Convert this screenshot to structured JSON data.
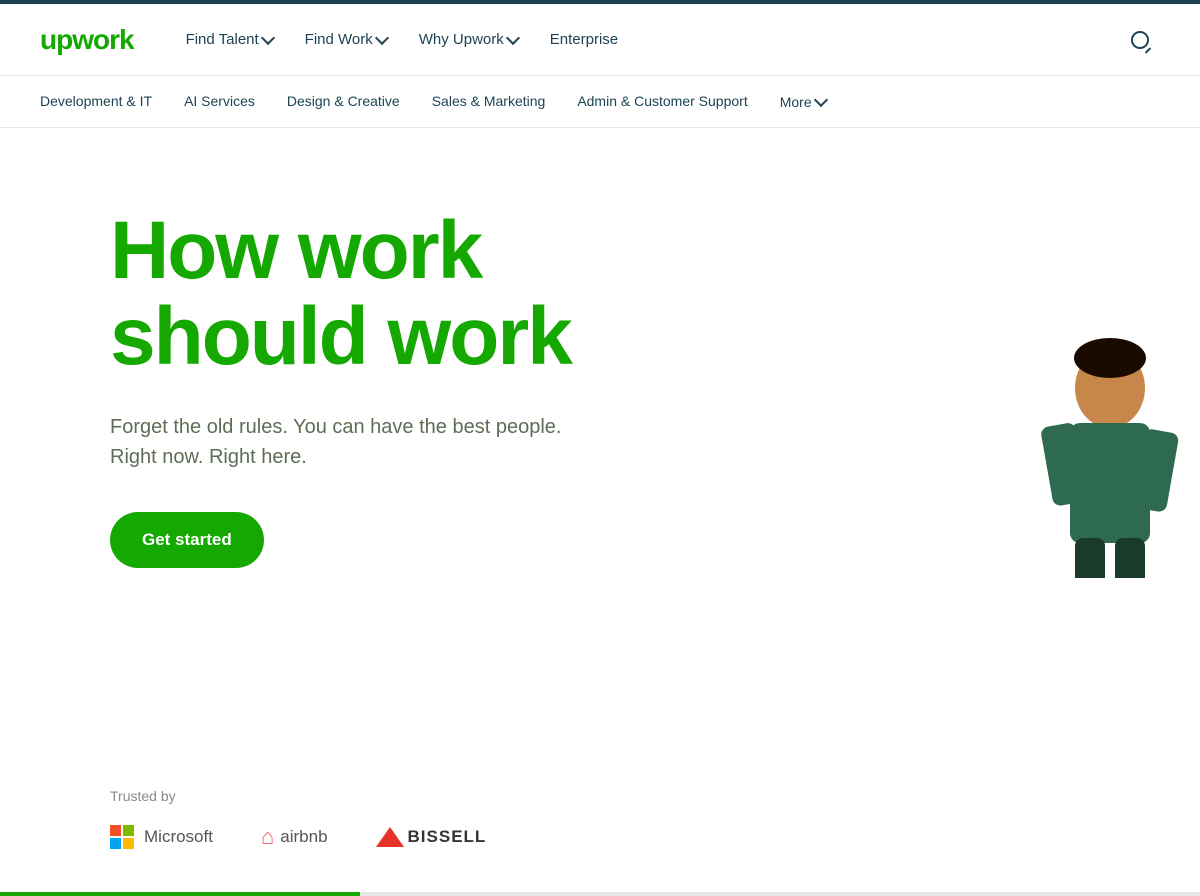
{
  "topbar": {},
  "nav": {
    "logo": "upwork",
    "links": [
      {
        "label": "Find Talent",
        "has_dropdown": true
      },
      {
        "label": "Find Work",
        "has_dropdown": true
      },
      {
        "label": "Why Upwork",
        "has_dropdown": true
      },
      {
        "label": "Enterprise",
        "has_dropdown": false
      }
    ],
    "search_label": "Search"
  },
  "category_nav": {
    "items": [
      {
        "label": "Development & IT"
      },
      {
        "label": "AI Services"
      },
      {
        "label": "Design & Creative"
      },
      {
        "label": "Sales & Marketing"
      },
      {
        "label": "Admin & Customer Support"
      }
    ],
    "more_label": "More"
  },
  "hero": {
    "headline_line1": "How work",
    "headline_line2": "should work",
    "subtitle_line1": "Forget the old rules. You can have the best people.",
    "subtitle_line2": "Right now. Right here.",
    "cta_button": "Get started"
  },
  "trusted": {
    "label": "Trusted by",
    "logos": [
      {
        "name": "Microsoft"
      },
      {
        "name": "airbnb"
      },
      {
        "name": "BISSELL"
      }
    ]
  }
}
